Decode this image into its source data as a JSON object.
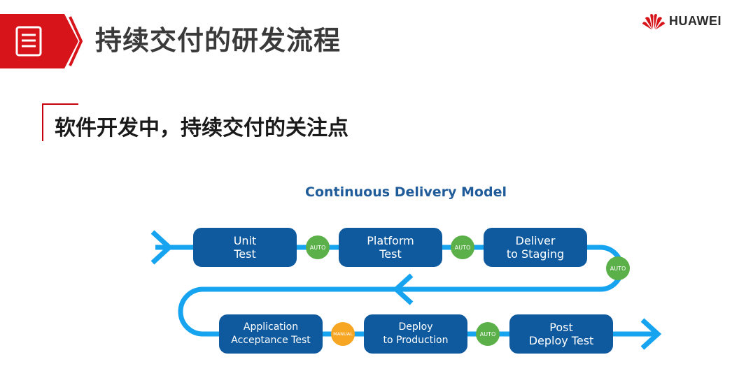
{
  "header": {
    "title": "持续交付的研发流程",
    "brand": "HUAWEI",
    "icon": "document-list-icon",
    "accent_color": "#d7141a"
  },
  "section": {
    "heading": "软件开发中，持续交付的关注点"
  },
  "diagram": {
    "title": "Continuous Delivery Model",
    "stage_color": "#0f5a9e",
    "track_color": "#16a3f0",
    "stages": [
      {
        "line1": "Unit",
        "line2": "Test"
      },
      {
        "line1": "Platform",
        "line2": "Test"
      },
      {
        "line1": "Deliver",
        "line2": "to Staging"
      },
      {
        "line1": "Application",
        "line2": "Acceptance Test"
      },
      {
        "line1": "Deploy",
        "line2": "to Production"
      },
      {
        "line1": "Post",
        "line2": "Deploy Test"
      }
    ],
    "gates": [
      {
        "label": "AUTO",
        "color": "#5cb04a"
      },
      {
        "label": "AUTO",
        "color": "#5cb04a"
      },
      {
        "label": "AUTO",
        "color": "#5cb04a"
      },
      {
        "label": "MANUAL",
        "color": "#f6a623"
      },
      {
        "label": "AUTO",
        "color": "#5cb04a"
      }
    ]
  }
}
